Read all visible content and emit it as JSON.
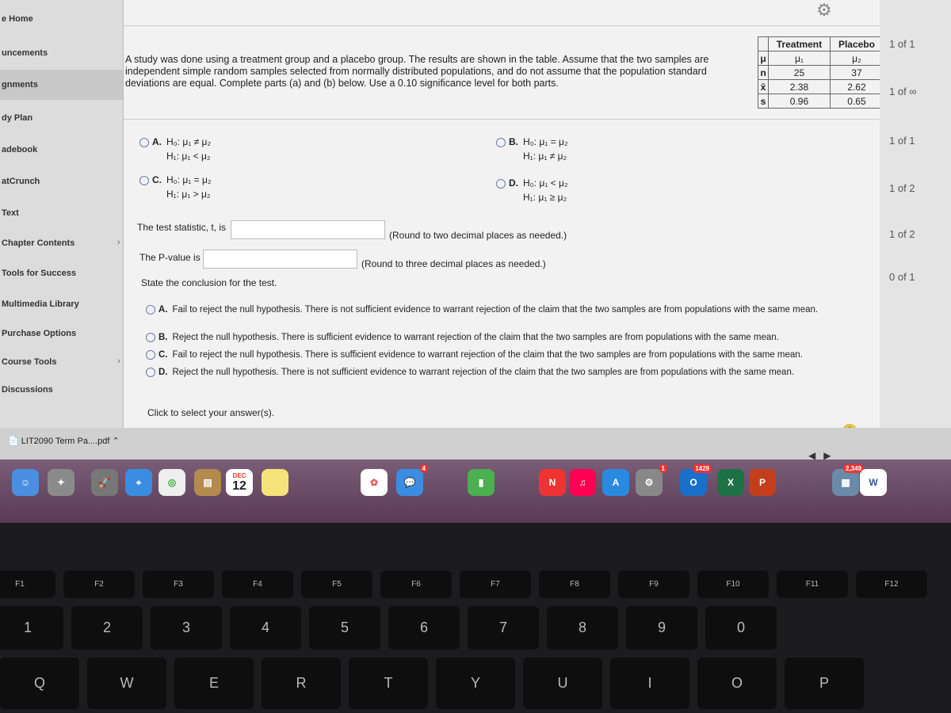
{
  "sidebar": {
    "items": [
      {
        "label": "e Home"
      },
      {
        "label": "uncements"
      },
      {
        "label": "gnments"
      },
      {
        "label": "dy Plan"
      },
      {
        "label": "adebook"
      },
      {
        "label": "atCrunch"
      },
      {
        "label": "Text"
      },
      {
        "label": "Chapter Contents"
      },
      {
        "label": "Tools for Success"
      },
      {
        "label": "Multimedia Library"
      },
      {
        "label": "Purchase Options"
      },
      {
        "label": "Course Tools"
      },
      {
        "label": "Discussions"
      }
    ]
  },
  "question": {
    "text": "A study was done using a treatment group and a placebo group. The results are shown in the table. Assume that the two samples are independent simple random samples selected from normally distributed populations, and do not assume that the population standard deviations are equal. Complete parts (a) and (b) below. Use a 0.10 significance level for both parts."
  },
  "table": {
    "headers": [
      "",
      "Treatment",
      "Placebo"
    ],
    "rows": [
      [
        "μ",
        "μ₁",
        "μ₂"
      ],
      [
        "n",
        "25",
        "37"
      ],
      [
        "x̄",
        "2.38",
        "2.62"
      ],
      [
        "s",
        "0.96",
        "0.65"
      ]
    ]
  },
  "hypotheses": [
    {
      "letter": "A.",
      "h0": "H₀: μ₁ ≠ μ₂",
      "h1": "H₁: μ₁ < μ₂"
    },
    {
      "letter": "B.",
      "h0": "H₀: μ₁ = μ₂",
      "h1": "H₁: μ₁ ≠ μ₂"
    },
    {
      "letter": "C.",
      "h0": "H₀: μ₁ = μ₂",
      "h1": "H₁: μ₁ > μ₂"
    },
    {
      "letter": "D.",
      "h0": "H₀: μ₁ < μ₂",
      "h1": "H₁: μ₁ ≥ μ₂"
    }
  ],
  "test_stat": {
    "label": "The test statistic, t, is",
    "value": "",
    "hint": "(Round to two decimal places as needed.)"
  },
  "p_value": {
    "label": "The P-value is",
    "value": "",
    "hint": "(Round to three decimal places as needed.)"
  },
  "conclusion": {
    "label": "State the conclusion for the test.",
    "options": [
      {
        "letter": "A.",
        "text": "Fail to reject the null hypothesis. There is not sufficient evidence to warrant rejection of the claim that the two samples are from populations with the same mean."
      },
      {
        "letter": "B.",
        "text": "Reject the null hypothesis. There is sufficient evidence to warrant rejection of the claim that the two samples are from populations with the same mean."
      },
      {
        "letter": "C.",
        "text": "Fail to reject the null hypothesis. There is sufficient evidence to warrant rejection of the claim that the two samples are from populations with the same mean."
      },
      {
        "letter": "D.",
        "text": "Reject the null hypothesis. There is not sufficient evidence to warrant rejection of the claim that the two samples are from populations with the same mean."
      }
    ]
  },
  "footer": {
    "click_text": "Click to select your answer(s).",
    "help": "?"
  },
  "right_counts": [
    "1 of 1",
    "1 of ∞",
    "1 of 1",
    "1 of 2",
    "1 of 2",
    "0 of 1"
  ],
  "download": {
    "file": "LIT2090 Term Pa....pdf"
  },
  "dock": {
    "calendar_month": "DEC",
    "calendar_day": "12",
    "badges": [
      "4",
      "1",
      "1429",
      "2,349"
    ],
    "apps": [
      "X",
      "P",
      "W",
      "O"
    ]
  },
  "keyboard": {
    "numbers": [
      "1",
      "2",
      "3",
      "4",
      "5",
      "6",
      "7",
      "8",
      "9",
      "0"
    ],
    "letters": [
      "Q",
      "W",
      "E",
      "R",
      "T",
      "Y",
      "U",
      "I",
      "O",
      "P"
    ]
  },
  "colors": {
    "dock": "#6b4d68",
    "accent": "#6b7ba8"
  }
}
